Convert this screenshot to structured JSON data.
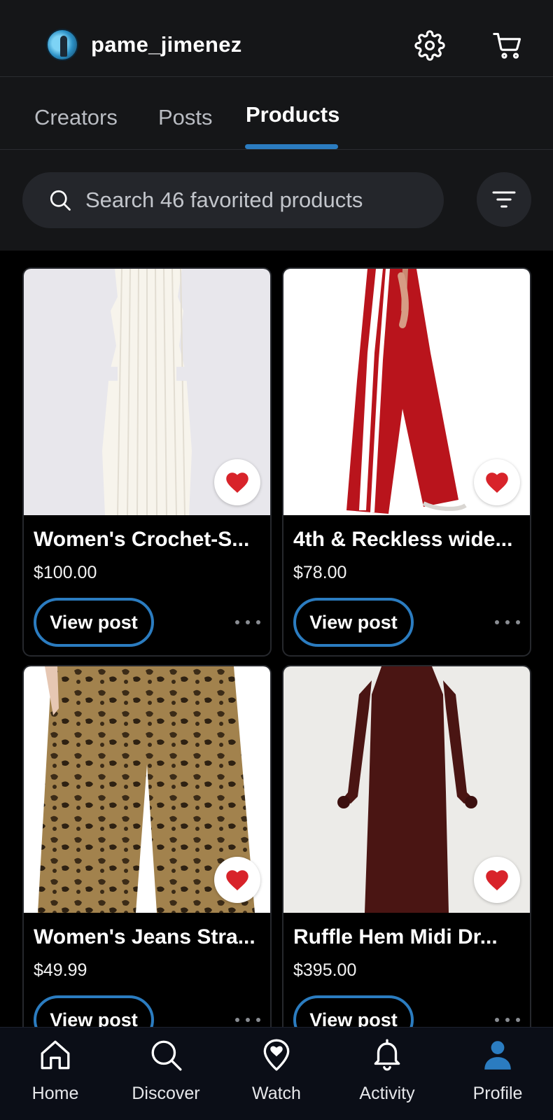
{
  "header": {
    "username": "pame_jimenez",
    "icons": [
      "gear-icon",
      "cart-icon"
    ]
  },
  "tabs": [
    {
      "label": "Creators",
      "active": false
    },
    {
      "label": "Posts",
      "active": false
    },
    {
      "label": "Products",
      "active": true
    }
  ],
  "search": {
    "placeholder": "Search 46 favorited products",
    "value": ""
  },
  "products": [
    {
      "title": "Women's Crochet-S...",
      "price": "$100.00",
      "button": "View post",
      "favorited": true
    },
    {
      "title": "4th & Reckless wide...",
      "price": "$78.00",
      "button": "View post",
      "favorited": true
    },
    {
      "title": "Women's Jeans Stra...",
      "price": "$49.99",
      "button": "View post",
      "favorited": true
    },
    {
      "title": "Ruffle Hem Midi Dr...",
      "price": "$395.00",
      "button": "View post",
      "favorited": true
    }
  ],
  "bottom_nav": [
    {
      "label": "Home",
      "icon": "home-icon",
      "active": false
    },
    {
      "label": "Discover",
      "icon": "search-icon",
      "active": false
    },
    {
      "label": "Watch",
      "icon": "watch-heart-pin-icon",
      "active": false
    },
    {
      "label": "Activity",
      "icon": "bell-icon",
      "active": false
    },
    {
      "label": "Profile",
      "icon": "profile-icon",
      "active": true
    }
  ],
  "colors": {
    "accent": "#2b7cc0",
    "heart": "#d8232a",
    "background": "#000000",
    "surface": "#151618"
  }
}
